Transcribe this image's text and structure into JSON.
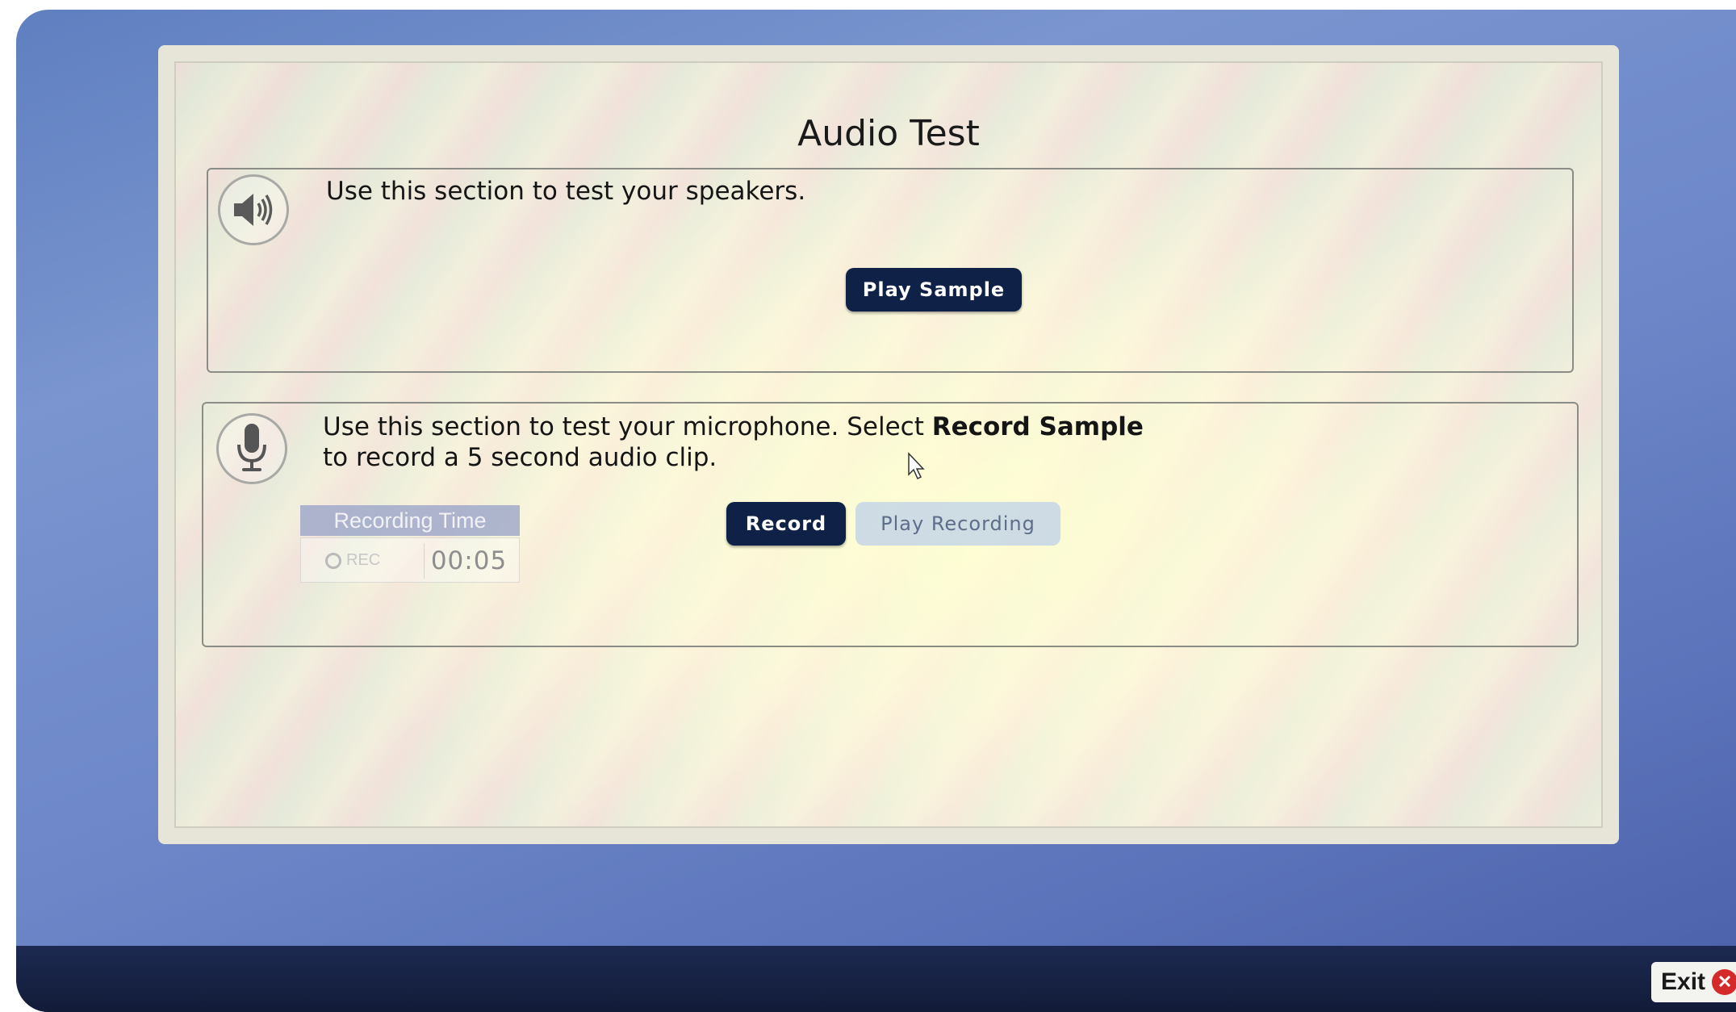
{
  "dialog": {
    "title": "Audio Test"
  },
  "speakers_section": {
    "icon": "speaker-icon",
    "instruction": "Use this section to test your speakers.",
    "play_sample_label": "Play Sample"
  },
  "microphone_section": {
    "icon": "microphone-icon",
    "instruction_prefix": "Use this section to test your microphone. Select ",
    "instruction_bold": "Record Sample",
    "instruction_suffix": "to record a 5 second audio clip.",
    "recording_time_header": "Recording Time",
    "rec_label": "REC",
    "timer_value": "00:05",
    "record_label": "Record",
    "play_recording_label": "Play Recording"
  },
  "footer": {
    "exit_label": "Exit",
    "exit_icon": "close-circle-icon"
  },
  "colors": {
    "button_dark": "#0f2146",
    "button_disabled": "#b9cdeb",
    "exit_red": "#d42a2a",
    "bottom_bar": "#1c2950"
  }
}
